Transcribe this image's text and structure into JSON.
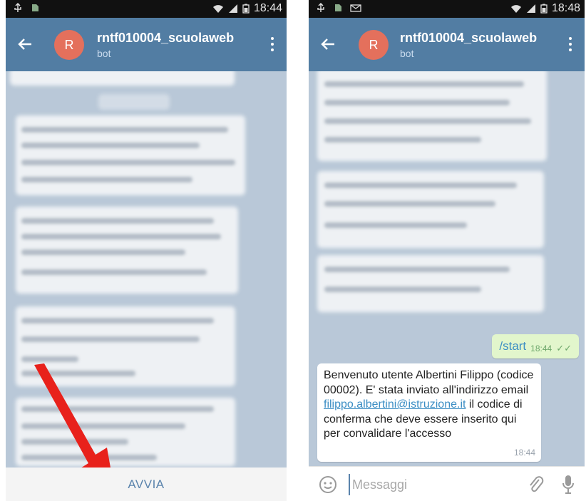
{
  "left_screen": {
    "status_time": "18:44",
    "chat_title": "rntf010004_scuolaweb",
    "chat_subtitle": "bot",
    "avatar_letter": "R",
    "bottom_button": "AVVIA"
  },
  "right_screen": {
    "status_time": "18:48",
    "chat_title": "rntf010004_scuolaweb",
    "chat_subtitle": "bot",
    "avatar_letter": "R",
    "sent_message": {
      "text": "/start",
      "time": "18:44"
    },
    "received_message": {
      "text_before_link": "Benvenuto utente Albertini Filippo (codice 00002). E' stata inviato all'indirizzo email ",
      "link": "filippo.albertini@istruzione.it",
      "text_after_link": " il codice di conferma che deve essere inserito qui per convalidare l'accesso",
      "time": "18:44"
    },
    "input_placeholder": "Messaggi"
  },
  "colors": {
    "appbar": "#527da3",
    "avatar": "#e4705c",
    "chat_bg": "#b9c8d8",
    "sent_bubble": "#e2f6cc",
    "link": "#3c8ec4",
    "arrow": "#e8211b"
  },
  "icons": [
    "usb-icon",
    "sd-card-icon",
    "message-icon",
    "wifi-icon",
    "signal-icon",
    "battery-icon",
    "back-arrow-icon",
    "more-vert-icon",
    "emoji-icon",
    "attach-icon",
    "mic-icon",
    "double-check-icon"
  ]
}
